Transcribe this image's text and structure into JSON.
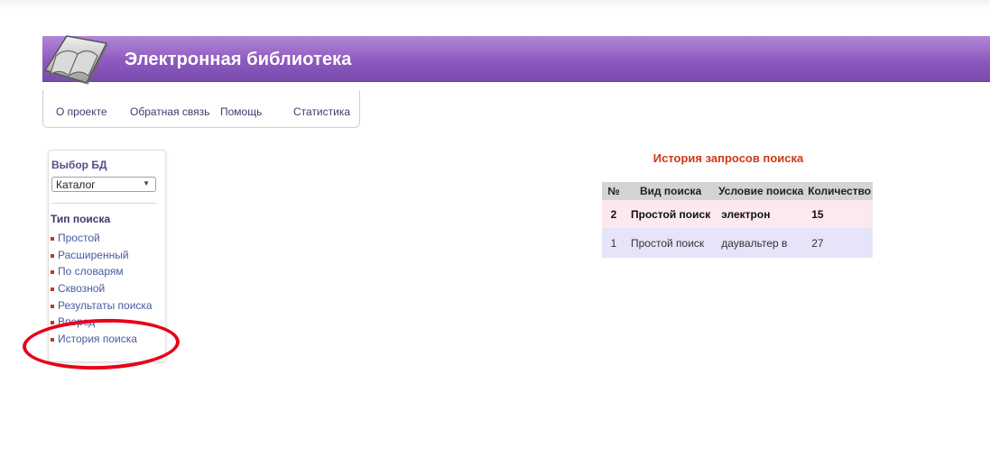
{
  "header": {
    "title": "Электронная библиотека"
  },
  "nav": {
    "items": [
      "О проекте",
      "Обратная связь",
      "Помощь",
      "Статистика"
    ]
  },
  "sidebar": {
    "db_heading": "Выбор БД",
    "db_selected": "Каталог",
    "search_type_heading": "Тип поиска",
    "items": [
      "Простой",
      "Расширенный",
      "По словарям",
      "Сквозной",
      "Результаты поиска",
      "Вперед",
      "История поиска"
    ]
  },
  "history": {
    "title": "История запросов поиска",
    "columns": [
      "№",
      "Вид поиска",
      "Условие поиска",
      "Количество"
    ],
    "rows": [
      {
        "num": "2",
        "type": "Простой поиск",
        "condition": "электрон",
        "count": "15"
      },
      {
        "num": "1",
        "type": "Простой поиск",
        "condition": "даувальтер в",
        "count": "27"
      }
    ]
  },
  "colors": {
    "header_purple": "#8d5bbf",
    "annotation_red": "#e8001a",
    "title_orange": "#cc3a14"
  }
}
